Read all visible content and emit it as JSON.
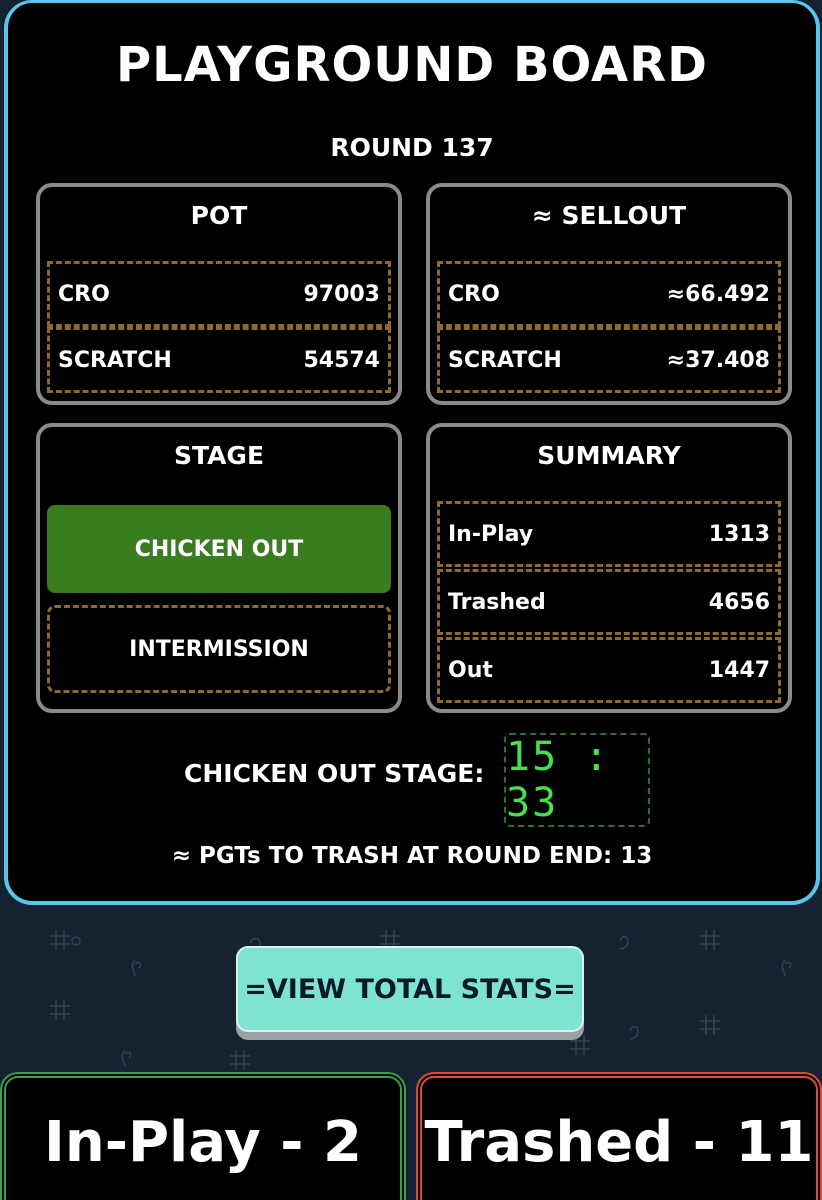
{
  "board": {
    "title": "PLAYGROUND BOARD",
    "round": "ROUND 137"
  },
  "pot": {
    "title": "POT",
    "rows": [
      {
        "label": "CRO",
        "value": "97003"
      },
      {
        "label": "SCRATCH",
        "value": "54574"
      }
    ]
  },
  "sellout": {
    "title": "≈ SELLOUT",
    "rows": [
      {
        "label": "CRO",
        "value": "≈66.492"
      },
      {
        "label": "SCRATCH",
        "value": "≈37.408"
      }
    ]
  },
  "stage": {
    "title": "STAGE",
    "active": "CHICKEN OUT",
    "next": "INTERMISSION"
  },
  "summary": {
    "title": "SUMMARY",
    "rows": [
      {
        "label": "In-Play",
        "value": "1313"
      },
      {
        "label": "Trashed",
        "value": "4656"
      },
      {
        "label": "Out",
        "value": "1447"
      }
    ]
  },
  "countdown": {
    "label": "CHICKEN OUT STAGE:",
    "timer": "15 : 33"
  },
  "trash_line": "≈ PGTs TO TRASH AT ROUND END: 13",
  "stats_button": "=VIEW TOTAL STATS=",
  "bottom": {
    "in_play": "In-Play - 2",
    "trashed": "Trashed - 11"
  },
  "colors": {
    "board_border": "#57c6ea",
    "active_stage": "#3a7d21",
    "timer": "#47e04f",
    "stats_button": "#7fe3d3",
    "in_play_border": "#3aa04a",
    "trashed_border": "#e04a3a"
  }
}
